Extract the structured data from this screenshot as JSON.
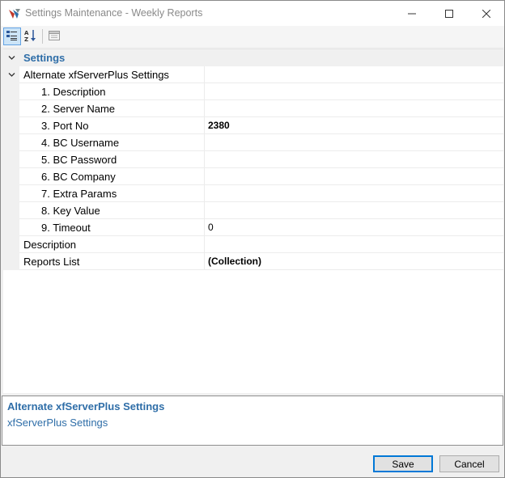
{
  "window": {
    "title": "Settings Maintenance - Weekly Reports",
    "icons": {
      "app": "app-logo-icon",
      "minimize": "minimize-icon",
      "maximize": "maximize-icon",
      "close": "close-icon"
    }
  },
  "toolbar": {
    "buttons": [
      {
        "name": "categorized-view",
        "icon": "categorized-icon",
        "active": true
      },
      {
        "name": "alphabetical-sort",
        "icon": "sort-az-icon",
        "active": false
      },
      {
        "name": "property-pages",
        "icon": "property-pages-icon",
        "active": false
      }
    ]
  },
  "grid": {
    "category": {
      "label": "Settings",
      "expanded": true
    },
    "group": {
      "label": "Alternate xfServerPlus Settings",
      "expanded": true
    },
    "group_items": [
      {
        "name": "1. Description",
        "value": ""
      },
      {
        "name": "2. Server Name",
        "value": ""
      },
      {
        "name": "3. Port No",
        "value": "2380"
      },
      {
        "name": "4. BC Username",
        "value": ""
      },
      {
        "name": "5. BC Password",
        "value": ""
      },
      {
        "name": "6. BC Company",
        "value": ""
      },
      {
        "name": "7. Extra Params",
        "value": ""
      },
      {
        "name": "8. Key Value",
        "value": ""
      },
      {
        "name": "9. Timeout",
        "value": "0"
      }
    ],
    "items": [
      {
        "name": "Description",
        "value": ""
      },
      {
        "name": "Reports List",
        "value": "(Collection)"
      }
    ]
  },
  "description_pane": {
    "title": "Alternate xfServerPlus Settings",
    "text": "xfServerPlus Settings"
  },
  "buttons": {
    "save": "Save",
    "cancel": "Cancel"
  },
  "colors": {
    "accent": "#2f6ea8",
    "focus_border": "#0078d7",
    "selected_toolbar_bg": "#cce4f7"
  }
}
